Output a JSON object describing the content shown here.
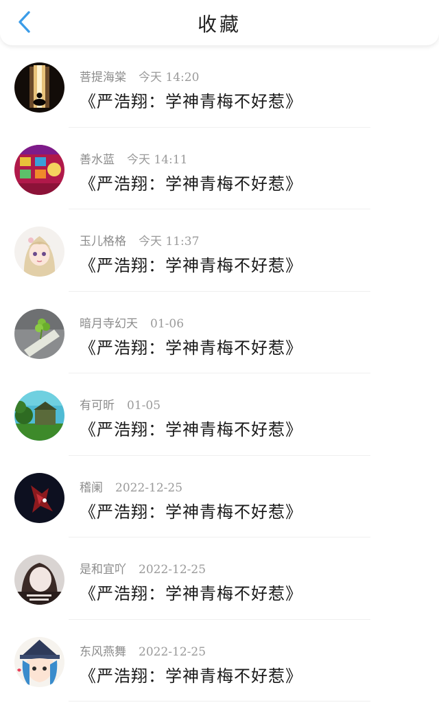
{
  "header": {
    "title": "收藏",
    "back_icon": "chevron-left-icon",
    "accent_color": "#3b9ce8"
  },
  "items": [
    {
      "name": "菩提海棠",
      "time": "今天 14:20",
      "title": "《严浩翔：学神青梅不好惹》"
    },
    {
      "name": "善水蓝",
      "time": "今天 14:11",
      "title": "《严浩翔：学神青梅不好惹》"
    },
    {
      "name": "玉儿格格",
      "time": "今天 11:37",
      "title": "《严浩翔：学神青梅不好惹》"
    },
    {
      "name": "暗月寺幻天",
      "time": "01-06",
      "title": "《严浩翔：学神青梅不好惹》"
    },
    {
      "name": "有可昕",
      "time": "01-05",
      "title": "《严浩翔：学神青梅不好惹》"
    },
    {
      "name": "稽阑",
      "time": "2022-12-25",
      "title": "《严浩翔：学神青梅不好惹》"
    },
    {
      "name": "是和宜吖",
      "time": "2022-12-25",
      "title": "《严浩翔：学神青梅不好惹》"
    },
    {
      "name": "东风燕舞",
      "time": "2022-12-25",
      "title": "《严浩翔：学神青梅不好惹》"
    }
  ]
}
